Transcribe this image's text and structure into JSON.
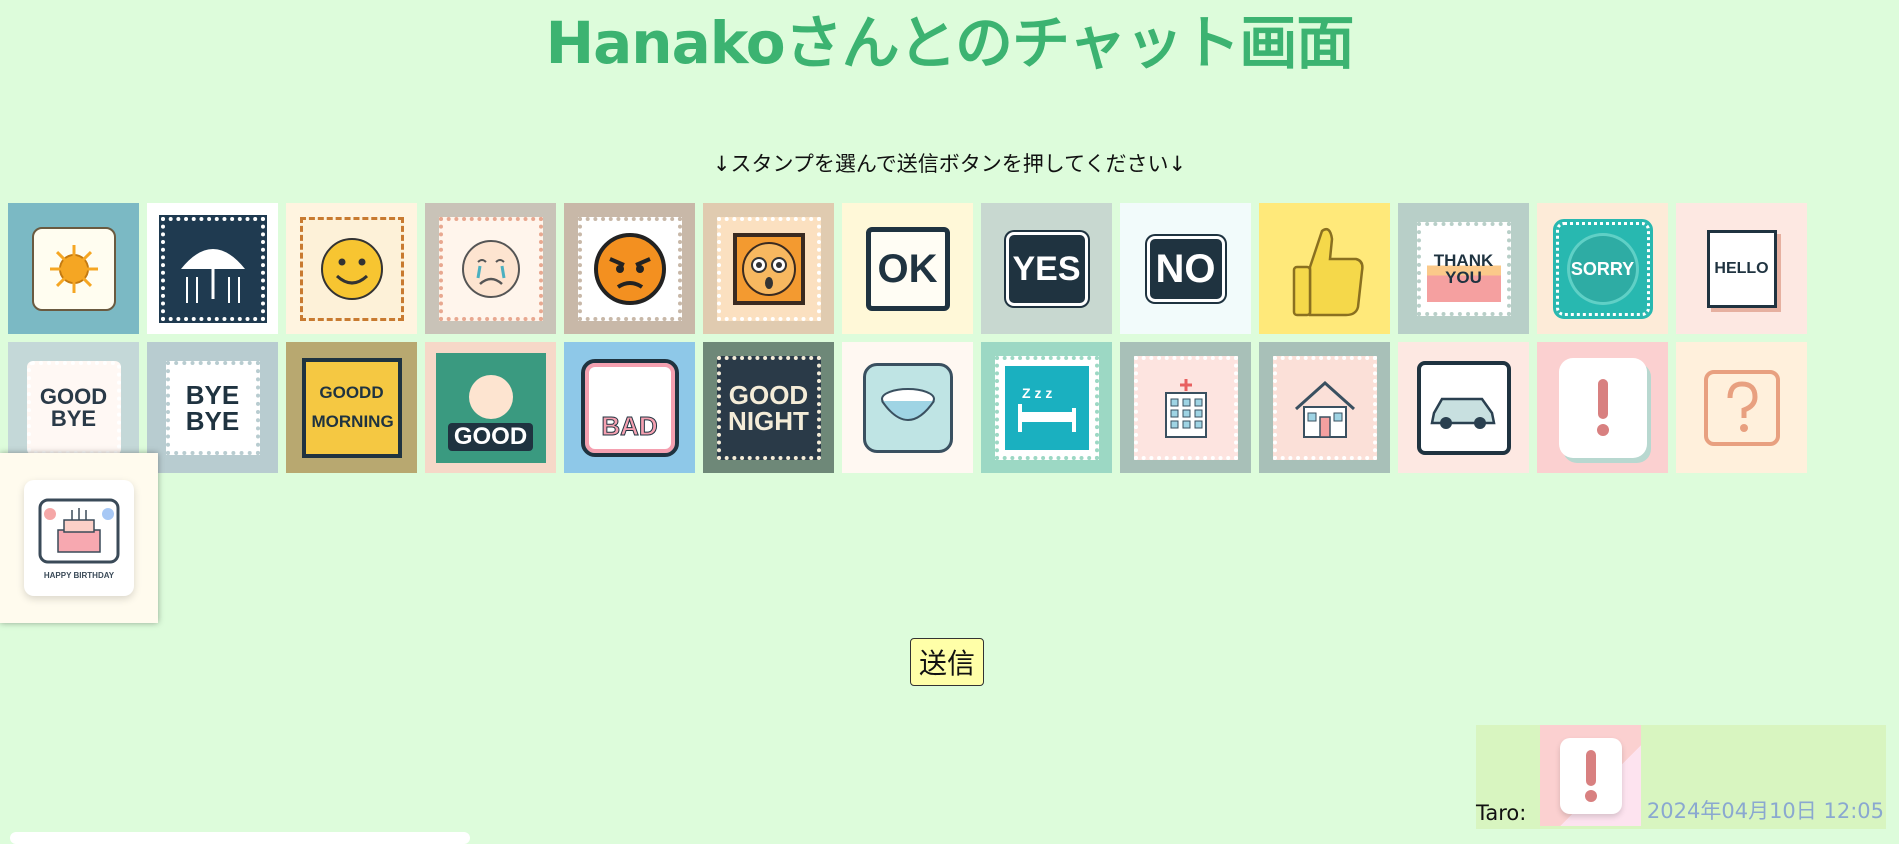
{
  "page": {
    "title": "Hanakoさんとのチャット画面",
    "instruction": "↓スタンプを選んで送信ボタンを押してください↓",
    "send_label": "送信"
  },
  "stamps": [
    {
      "id": "sun",
      "icon": "sun-icon",
      "bg": "#7bb9c4"
    },
    {
      "id": "rain",
      "icon": "umbrella-icon",
      "bg": "#ffffff"
    },
    {
      "id": "smile",
      "icon": "smile-icon",
      "bg": "#fff4e0"
    },
    {
      "id": "cry",
      "icon": "cry-icon",
      "bg": "#c9c3b8"
    },
    {
      "id": "angry",
      "icon": "angry-icon",
      "bg": "#c8b8a8"
    },
    {
      "id": "surprised",
      "icon": "surprised-icon",
      "bg": "#e0cbb0"
    },
    {
      "id": "ok",
      "icon": "ok-icon",
      "bg": "#fff8d8",
      "label": "OK"
    },
    {
      "id": "yes",
      "icon": "yes-icon",
      "bg": "#c8d8d0",
      "label": "YES"
    },
    {
      "id": "no",
      "icon": "no-icon",
      "bg": "#f2fbfb",
      "label": "NO"
    },
    {
      "id": "thumbs-up",
      "icon": "thumbs-up-icon",
      "bg": "#ffe97a"
    },
    {
      "id": "thank-you",
      "icon": "thank-you-icon",
      "bg": "#b8cfc8",
      "label": "THANK YOU"
    },
    {
      "id": "sorry",
      "icon": "sorry-icon",
      "bg": "#fdebd8",
      "label": "SORRY"
    },
    {
      "id": "hello",
      "icon": "hello-icon",
      "bg": "#fde8e2",
      "label": "HELLO"
    },
    {
      "id": "good-bye",
      "icon": "good-bye-icon",
      "bg": "#c4d8d8",
      "label": "GOOD BYE"
    },
    {
      "id": "bye-bye",
      "icon": "bye-bye-icon",
      "bg": "#b8ccd0",
      "label": "BYE BYE"
    },
    {
      "id": "good-morning",
      "icon": "good-morning-icon",
      "bg": "#b8a870",
      "label": "GOODD MORNING"
    },
    {
      "id": "good",
      "icon": "good-icon",
      "bg": "#f6d8c8",
      "label": "GOOD"
    },
    {
      "id": "bad",
      "icon": "bad-icon",
      "bg": "#8ec8e8",
      "label": "BAD"
    },
    {
      "id": "good-night",
      "icon": "good-night-icon",
      "bg": "#6e8878",
      "label": "GOOD NIGHT"
    },
    {
      "id": "rice",
      "icon": "rice-bowl-icon",
      "bg": "#fff8f2"
    },
    {
      "id": "sleep",
      "icon": "bed-icon",
      "bg": "#9cd8c4"
    },
    {
      "id": "hospital",
      "icon": "hospital-icon",
      "bg": "#a8c0b8"
    },
    {
      "id": "house",
      "icon": "house-icon",
      "bg": "#a8c0b8"
    },
    {
      "id": "car",
      "icon": "car-icon",
      "bg": "#fde8e2"
    },
    {
      "id": "exclaim",
      "icon": "exclamation-icon",
      "bg": "#fbd0d0"
    },
    {
      "id": "question",
      "icon": "question-icon",
      "bg": "#fff0dc"
    }
  ],
  "selected_stamp": {
    "id": "birthday",
    "icon": "birthday-cake-icon",
    "label": "HAPPY BIRTHDAY"
  },
  "message": {
    "sender": "Taro:",
    "stamp_icon": "exclamation-icon",
    "time": "2024年04月10日 12:05"
  }
}
